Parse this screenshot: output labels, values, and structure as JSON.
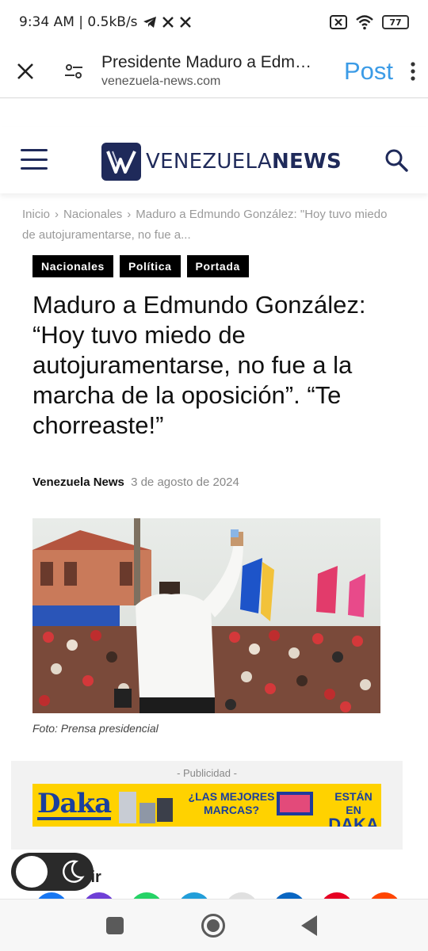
{
  "status_bar": {
    "time_info": "9:34 AM | 0.5kB/s",
    "app_icons": [
      "telegram-icon",
      "x-icon",
      "x-icon"
    ],
    "battery": "77",
    "system_icons": [
      "close-box-icon",
      "wifi-icon",
      "battery-icon"
    ]
  },
  "browser": {
    "title": "Presidente Maduro a Edmundo González",
    "domain": "venezuela-news.com",
    "post_label": "Post",
    "accent_color": "#3b9be6"
  },
  "site": {
    "logo_regular": "VENEZUELA",
    "logo_bold": "NEWS",
    "brand_color": "#1f2a5a"
  },
  "breadcrumb": {
    "home": "Inicio",
    "section": "Nacionales",
    "current": "Maduro a Edmundo González: \"Hoy tuvo miedo de autojuramentarse, no fue a..."
  },
  "tags": [
    "Nacionales",
    "Política",
    "Portada"
  ],
  "article": {
    "headline": "Maduro a Edmundo González: “Hoy tuvo miedo de autojuramentarse, no fue a la marcha de la oposición”. “Te chorreaste!”",
    "author": "Venezuela News",
    "date": "3 de agosto de 2024",
    "photo_caption": "Foto: Prensa presidencial"
  },
  "ad": {
    "label": "- Publicidad -",
    "brand": "Daka",
    "message_1": "¿LAS MEJORES MARCAS?",
    "message_2_top": "ESTÁN EN",
    "message_2_big": "DAKA",
    "banner_color": "#ffd200"
  },
  "share": {
    "heading": "rtir",
    "colors": [
      "#1877f2",
      "#6e3fd6",
      "#25d366",
      "#229ed9",
      "#e0e0e0",
      "#0a66c2",
      "#e60023",
      "#ff4500"
    ]
  }
}
